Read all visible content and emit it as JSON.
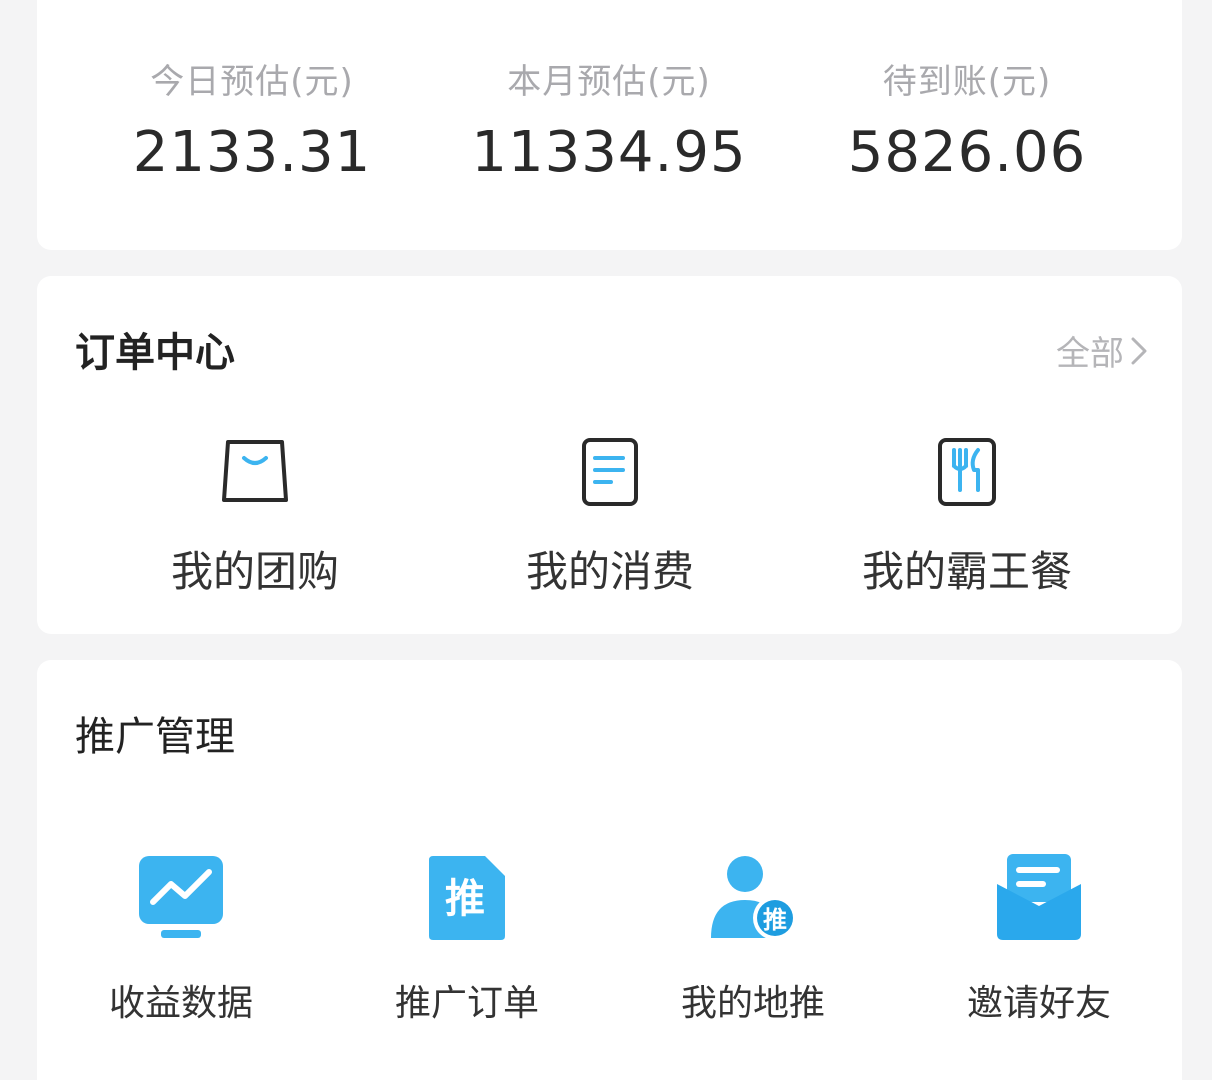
{
  "earnings": {
    "stats": [
      {
        "label": "今日预估(元)",
        "value": "2133.31"
      },
      {
        "label": "本月预估(元)",
        "value": "11334.95"
      },
      {
        "label": "待到账(元)",
        "value": "5826.06"
      }
    ]
  },
  "orders": {
    "title": "订单中心",
    "all_label": "全部",
    "items": [
      {
        "label": "我的团购",
        "icon": "shopping-bag-icon"
      },
      {
        "label": "我的消费",
        "icon": "receipt-icon"
      },
      {
        "label": "我的霸王餐",
        "icon": "utensils-icon"
      }
    ]
  },
  "promotion": {
    "title": "推广管理",
    "items": [
      {
        "label": "收益数据",
        "icon": "trend-chart-icon"
      },
      {
        "label": "推广订单",
        "icon": "promo-order-icon",
        "icon_text": "推"
      },
      {
        "label": "我的地推",
        "icon": "promoter-user-icon",
        "icon_text": "推"
      },
      {
        "label": "邀请好友",
        "icon": "invite-card-icon"
      }
    ]
  },
  "colors": {
    "accent": "#3cb4f0",
    "accent_dark": "#1e9de0",
    "text": "#2a2a2a",
    "muted": "#a9a9ad"
  }
}
